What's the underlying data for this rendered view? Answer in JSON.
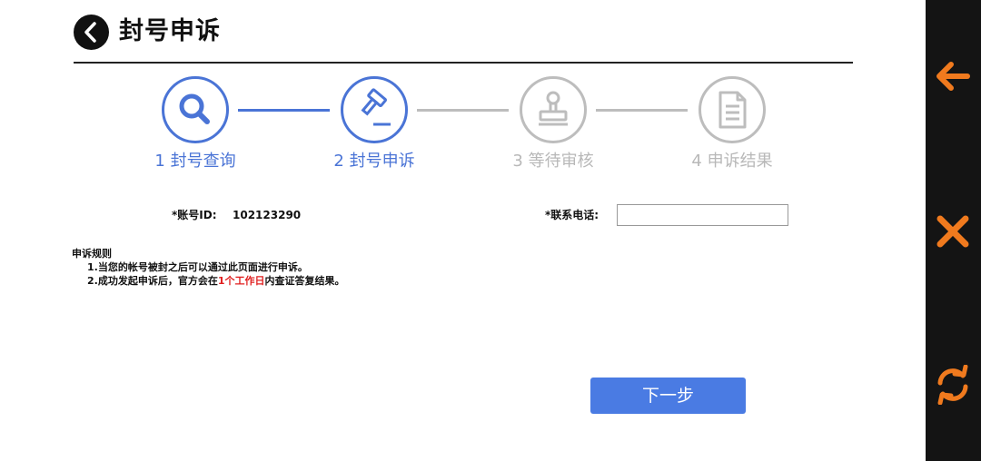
{
  "header": {
    "title": "封号申诉",
    "back_icon": "chevron-left-icon"
  },
  "stepper": {
    "steps": [
      {
        "label": "1 封号查询",
        "icon": "search-icon",
        "active": true
      },
      {
        "label": "2 封号申诉",
        "icon": "gavel-icon",
        "active": true
      },
      {
        "label": "3 等待审核",
        "icon": "stamp-icon",
        "active": false
      },
      {
        "label": "4 申诉结果",
        "icon": "document-icon",
        "active": false
      }
    ],
    "active_color": "#4a74d6",
    "inactive_color": "#bdbdbd"
  },
  "form": {
    "account_label": "*账号ID:",
    "account_value": "102123290",
    "phone_label": "*联系电话:",
    "phone_value": "",
    "phone_placeholder": ""
  },
  "rules": {
    "title": "申诉规则",
    "rule1": "1.当您的帐号被封之后可以通过此页面进行申诉。",
    "rule2_prefix": "2.成功发起申诉后，官方会在",
    "rule2_highlight": "1个工作日",
    "rule2_suffix": "内查证答复结果。",
    "highlight_color": "#e02020"
  },
  "actions": {
    "next_label": "下一步",
    "button_color": "#4a7be3"
  },
  "side_panel": {
    "buttons": [
      {
        "icon": "arrow-left-icon"
      },
      {
        "icon": "close-icon"
      },
      {
        "icon": "refresh-icon"
      }
    ],
    "icon_color": "#f07a1e"
  }
}
